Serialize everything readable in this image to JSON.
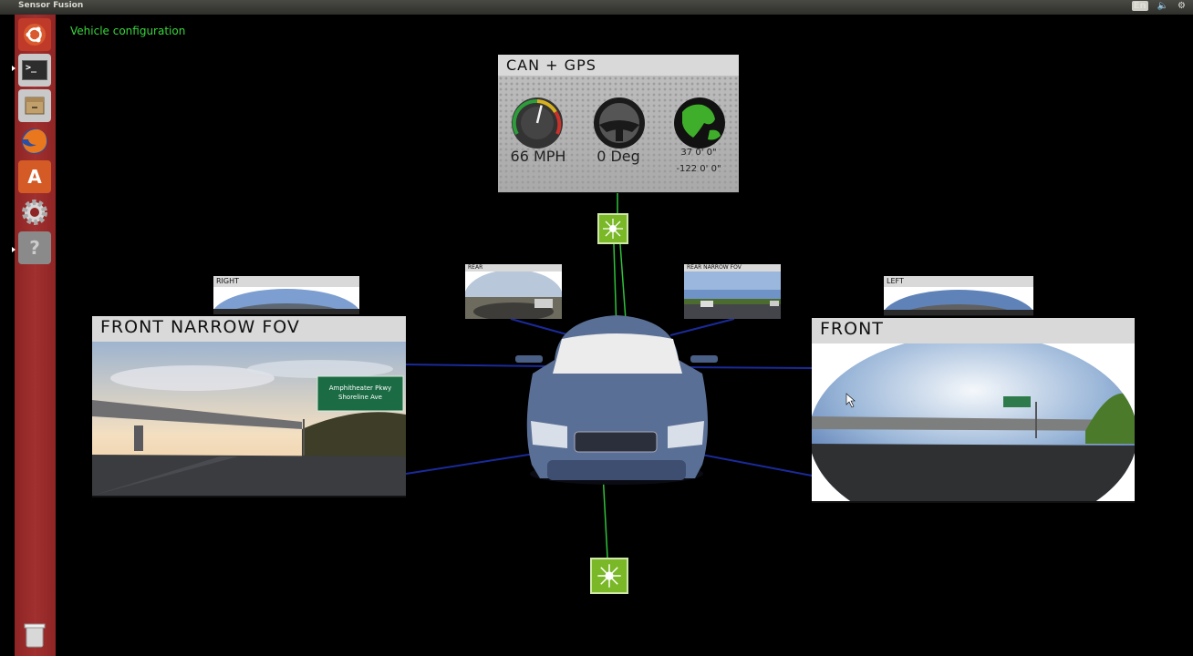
{
  "window": {
    "title": "Sensor Fusion"
  },
  "tray": {
    "keyboard": "En",
    "volume_icon": "volume-icon",
    "settings_icon": "gear-icon"
  },
  "launcher": {
    "items": [
      {
        "name": "dash-home",
        "icon": "ubuntu-logo-icon"
      },
      {
        "name": "terminal",
        "icon": "terminal-icon",
        "glyph": ">_"
      },
      {
        "name": "files",
        "icon": "file-cabinet-icon"
      },
      {
        "name": "firefox",
        "icon": "firefox-icon"
      },
      {
        "name": "software-center",
        "icon": "software-center-icon",
        "glyph": "A"
      },
      {
        "name": "system-settings",
        "icon": "settings-gear-icon"
      },
      {
        "name": "unknown-app",
        "icon": "question-mark-icon",
        "glyph": "?"
      }
    ],
    "trash_icon": "trash-icon"
  },
  "main": {
    "heading": "Vehicle configuration",
    "can_gps": {
      "title": "CAN + GPS",
      "speed": "66 MPH",
      "speed_value": 66,
      "steering": "0 Deg",
      "lat": "37 0' 0\"",
      "lon": "-122 0' 0\""
    },
    "cameras": {
      "front_narrow": {
        "title": "FRONT NARROW FOV",
        "sign_line1": "Amphitheater Pkwy",
        "sign_line2": "Shoreline Ave"
      },
      "front": {
        "title": "FRONT"
      },
      "right": {
        "title": "RIGHT"
      },
      "rear": {
        "title": "REAR"
      },
      "rear_narrow": {
        "title": "REAR NARROW FOV"
      },
      "left": {
        "title": "LEFT"
      }
    },
    "sensor_nodes": [
      {
        "name": "sensor-node-top",
        "icon": "radar-burst-icon"
      },
      {
        "name": "sensor-node-bottom",
        "icon": "radar-burst-icon"
      }
    ],
    "colors": {
      "accent_green": "#39d53c",
      "node_green": "#7ab827",
      "link_blue": "#1a2a9a",
      "car_blue": "#5a6f95"
    }
  }
}
